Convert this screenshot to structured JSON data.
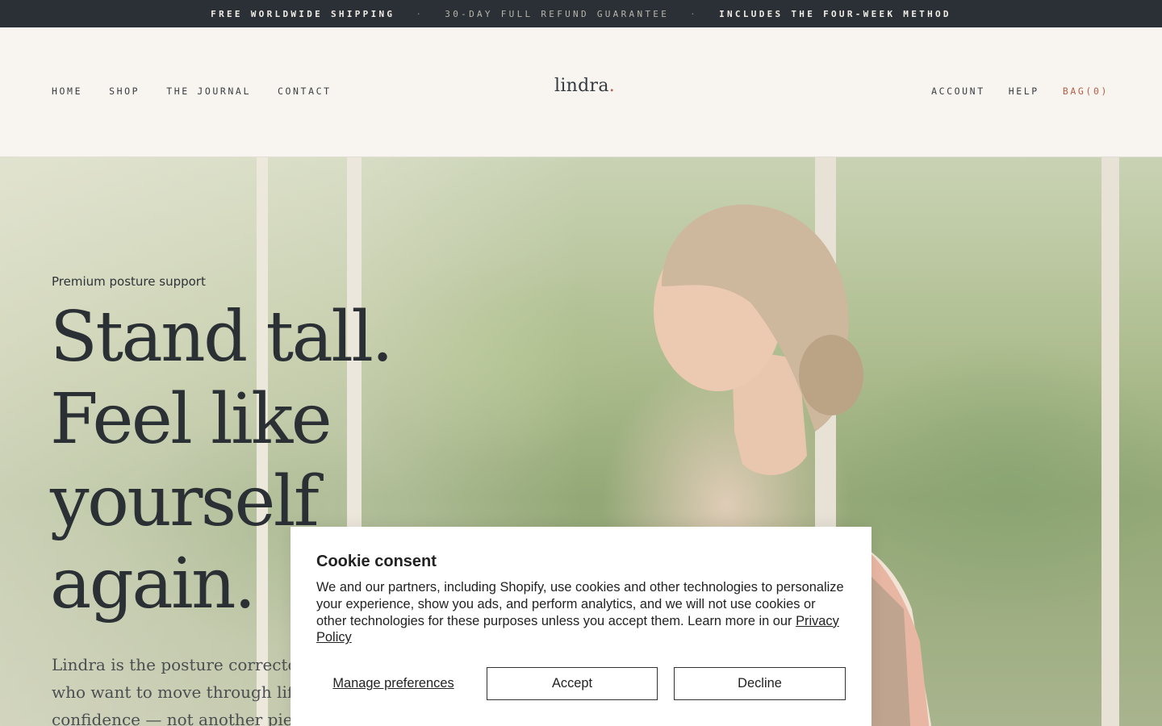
{
  "announcement": {
    "items": [
      "FREE WORLDWIDE SHIPPING",
      "30-DAY FULL REFUND GUARANTEE",
      "INCLUDES THE FOUR-WEEK METHOD"
    ],
    "separator": "·"
  },
  "header": {
    "nav_left": [
      "HOME",
      "SHOP",
      "THE JOURNAL",
      "CONTACT"
    ],
    "logo": "lindra",
    "logo_dot": ".",
    "nav_right": [
      "ACCOUNT",
      "HELP",
      "BAG(0)"
    ]
  },
  "hero": {
    "eyebrow": "Premium posture support",
    "headline_lines": [
      "Stand tall.",
      "Feel like",
      "yourself",
      "again."
    ],
    "body": "Lindra is the posture corrector designed for women who want to move through life with ease and quiet confidence — not another piece of"
  },
  "cookie": {
    "title": "Cookie consent",
    "text": "We and our partners, including Shopify, use cookies and other technologies to personalize your experience, show you ads, and perform analytics, and we will not use cookies or other technologies for these purposes unless you accept them. Learn more in our ",
    "privacy_link": "Privacy Policy",
    "manage_label": "Manage preferences",
    "accept_label": "Accept",
    "decline_label": "Decline"
  },
  "colors": {
    "announcement_bg": "#2a3036",
    "header_bg": "#f8f4ef",
    "accent": "#b3614a",
    "text_dark": "#2a3034"
  }
}
